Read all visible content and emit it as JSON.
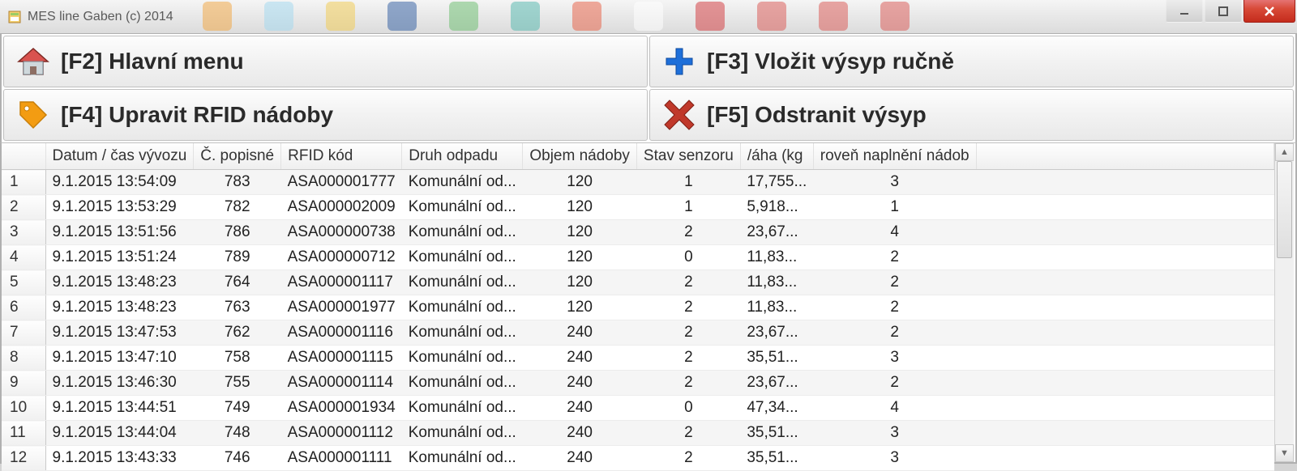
{
  "window": {
    "title": "MES line Gaben (c) 2014"
  },
  "toolbar": {
    "f2": "[F2] Hlavní menu",
    "f3": "[F3] Vložit výsyp ručně",
    "f4": "[F4] Upravit RFID nádoby",
    "f5": "[F5] Odstranit výsyp"
  },
  "columns": {
    "datum": "Datum / čas vývozu",
    "popisne": "Č. popisné",
    "rfid": "RFID kód",
    "druh": "Druh odpadu",
    "objem": "Objem nádoby",
    "stav": "Stav senzoru",
    "vaha": "/áha (kg",
    "uroven": "roveň naplnění nádob"
  },
  "druh_text": "Komunální od...",
  "rows": [
    {
      "n": "1",
      "datum": "9.1.2015 13:54:09",
      "popisne": "783",
      "rfid": "ASA000001777",
      "objem": "120",
      "stav": "1",
      "vaha": "17,755...",
      "uroven": "3"
    },
    {
      "n": "2",
      "datum": "9.1.2015 13:53:29",
      "popisne": "782",
      "rfid": "ASA000002009",
      "objem": "120",
      "stav": "1",
      "vaha": "5,918...",
      "uroven": "1"
    },
    {
      "n": "3",
      "datum": "9.1.2015 13:51:56",
      "popisne": "786",
      "rfid": "ASA000000738",
      "objem": "120",
      "stav": "2",
      "vaha": "23,67...",
      "uroven": "4"
    },
    {
      "n": "4",
      "datum": "9.1.2015 13:51:24",
      "popisne": "789",
      "rfid": "ASA000000712",
      "objem": "120",
      "stav": "0",
      "vaha": "11,83...",
      "uroven": "2"
    },
    {
      "n": "5",
      "datum": "9.1.2015 13:48:23",
      "popisne": "764",
      "rfid": "ASA000001117",
      "objem": "120",
      "stav": "2",
      "vaha": "11,83...",
      "uroven": "2"
    },
    {
      "n": "6",
      "datum": "9.1.2015 13:48:23",
      "popisne": "763",
      "rfid": "ASA000001977",
      "objem": "120",
      "stav": "2",
      "vaha": "11,83...",
      "uroven": "2"
    },
    {
      "n": "7",
      "datum": "9.1.2015 13:47:53",
      "popisne": "762",
      "rfid": "ASA000001116",
      "objem": "240",
      "stav": "2",
      "vaha": "23,67...",
      "uroven": "2"
    },
    {
      "n": "8",
      "datum": "9.1.2015 13:47:10",
      "popisne": "758",
      "rfid": "ASA000001115",
      "objem": "240",
      "stav": "2",
      "vaha": "35,51...",
      "uroven": "3"
    },
    {
      "n": "9",
      "datum": "9.1.2015 13:46:30",
      "popisne": "755",
      "rfid": "ASA000001114",
      "objem": "240",
      "stav": "2",
      "vaha": "23,67...",
      "uroven": "2"
    },
    {
      "n": "10",
      "datum": "9.1.2015 13:44:51",
      "popisne": "749",
      "rfid": "ASA000001934",
      "objem": "240",
      "stav": "0",
      "vaha": "47,34...",
      "uroven": "4"
    },
    {
      "n": "11",
      "datum": "9.1.2015 13:44:04",
      "popisne": "748",
      "rfid": "ASA000001112",
      "objem": "240",
      "stav": "2",
      "vaha": "35,51...",
      "uroven": "3"
    },
    {
      "n": "12",
      "datum": "9.1.2015 13:43:33",
      "popisne": "746",
      "rfid": "ASA000001111",
      "objem": "240",
      "stav": "2",
      "vaha": "35,51...",
      "uroven": "3"
    }
  ],
  "taskbar_colors": [
    "#f2a33c",
    "#a0d8ef",
    "#f2c94c",
    "#2c5aa0",
    "#66bb6a",
    "#4db6ac",
    "#E85C3F",
    "#ffffff",
    "#D13438",
    "#d9534f",
    "#d9534f",
    "#d9534f"
  ]
}
